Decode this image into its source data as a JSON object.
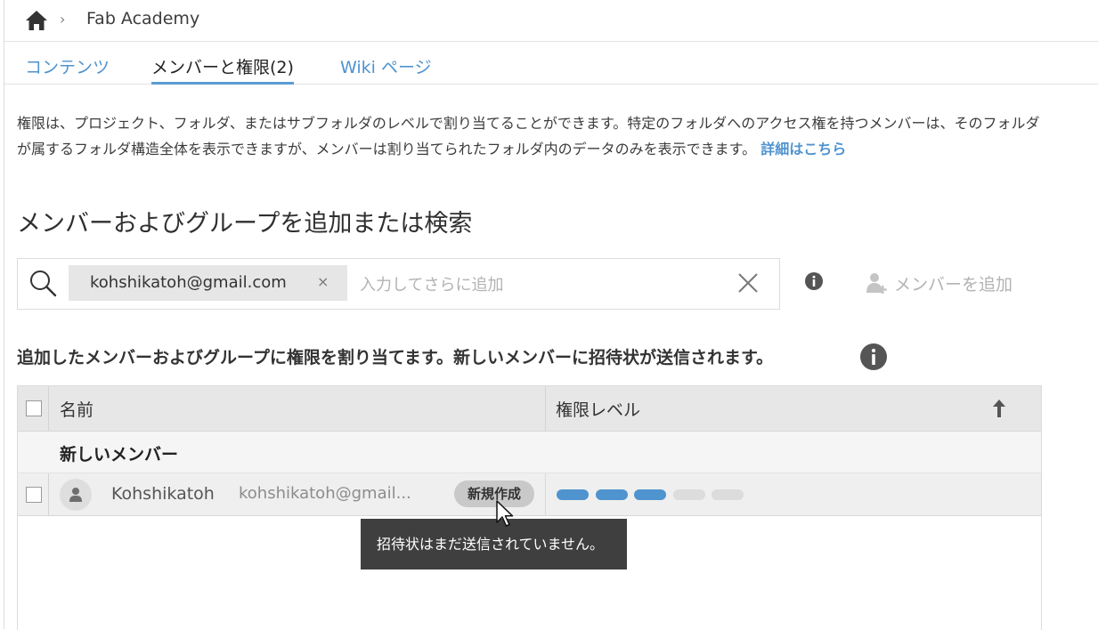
{
  "breadcrumb": {
    "title": "Fab Academy",
    "separator": "›"
  },
  "tabs": [
    {
      "label": "コンテンツ",
      "active": false
    },
    {
      "label": "メンバーと権限(2)",
      "active": true
    },
    {
      "label": "Wiki ページ",
      "active": false
    }
  ],
  "description": {
    "text": "権限は、プロジェクト、フォルダ、またはサブフォルダのレベルで割り当てることができます。特定のフォルダへのアクセス権を持つメンバーは、そのフォルダが属するフォルダ構造全体を表示できますが、メンバーは割り当てられたフォルダ内のデータのみを表示できます。",
    "link": "詳細はこちら"
  },
  "section_title": "メンバーおよびグループを追加または検索",
  "search": {
    "chip": "kohshikatoh@gmail.com",
    "chip_remove": "×",
    "placeholder": "入力してさらに追加",
    "value": ""
  },
  "add_member_label": "メンバーを追加",
  "assign_text": "追加したメンバーおよびグループに権限を割り当てます。新しいメンバーに招待状が送信されます。",
  "table": {
    "headers": {
      "name": "名前",
      "permission": "権限レベル"
    },
    "group_label": "新しいメンバー",
    "rows": [
      {
        "name": "Kohshikatoh",
        "email": "kohshikatoh@gmail...",
        "badge": "新規作成",
        "permission_level": 3,
        "permission_max": 5
      }
    ]
  },
  "tooltip": "招待状はまだ送信されていません。",
  "colors": {
    "accent": "#4f93cf",
    "level_on": "#4f93cf",
    "level_off": "#dcdcdc",
    "tooltip_bg": "#3f3f3f"
  }
}
